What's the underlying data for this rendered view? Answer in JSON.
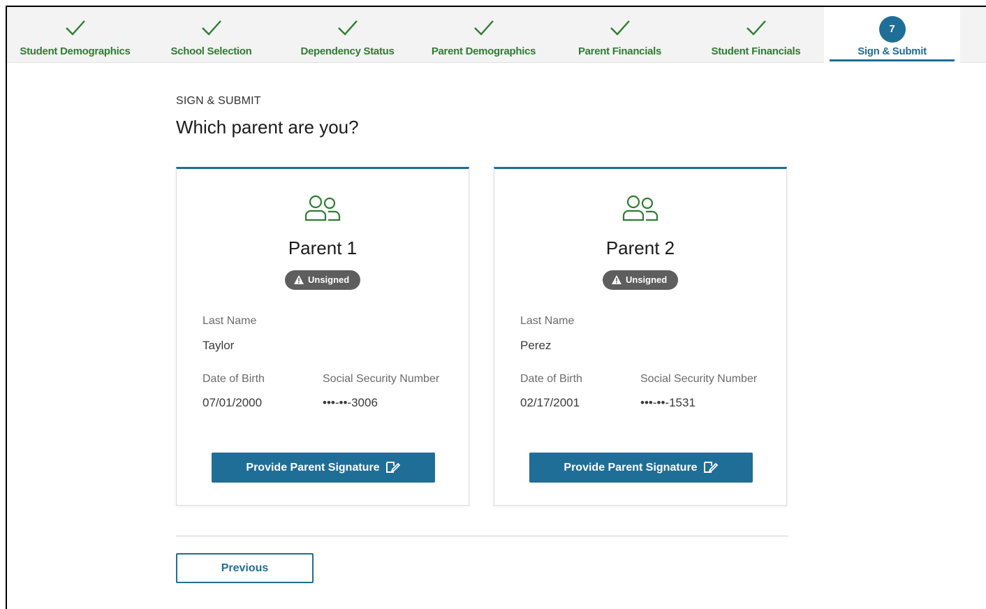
{
  "colors": {
    "accent": "#1f6e97",
    "complete": "#2e7d32",
    "badge": "#5e5e5e"
  },
  "stepper": {
    "steps": [
      {
        "label": "Student Demographics",
        "status": "complete",
        "icon": "check-icon"
      },
      {
        "label": "School Selection",
        "status": "complete",
        "icon": "check-icon"
      },
      {
        "label": "Dependency Status",
        "status": "complete",
        "icon": "check-icon"
      },
      {
        "label": "Parent Demographics",
        "status": "complete",
        "icon": "check-icon"
      },
      {
        "label": "Parent Financials",
        "status": "complete",
        "icon": "check-icon"
      },
      {
        "label": "Student Financials",
        "status": "complete",
        "icon": "check-icon"
      },
      {
        "label": "Sign & Submit",
        "status": "active",
        "number": "7"
      }
    ]
  },
  "header": {
    "kicker": "SIGN & SUBMIT",
    "title": "Which parent are you?"
  },
  "cards": [
    {
      "title": "Parent 1",
      "icon": "people-icon",
      "badge": "Unsigned",
      "badge_icon": "warning-icon",
      "last_name_label": "Last Name",
      "last_name": "Taylor",
      "dob_label": "Date of Birth",
      "dob": "07/01/2000",
      "ssn_label": "Social Security Number",
      "ssn": "•••-••-3006",
      "button_label": "Provide Parent Signature",
      "button_icon": "signature-icon"
    },
    {
      "title": "Parent 2",
      "icon": "people-icon",
      "badge": "Unsigned",
      "badge_icon": "warning-icon",
      "last_name_label": "Last Name",
      "last_name": "Perez",
      "dob_label": "Date of Birth",
      "dob": "02/17/2001",
      "ssn_label": "Social Security Number",
      "ssn": "•••-••-1531",
      "button_label": "Provide Parent Signature",
      "button_icon": "signature-icon"
    }
  ],
  "footer": {
    "previous_label": "Previous"
  }
}
